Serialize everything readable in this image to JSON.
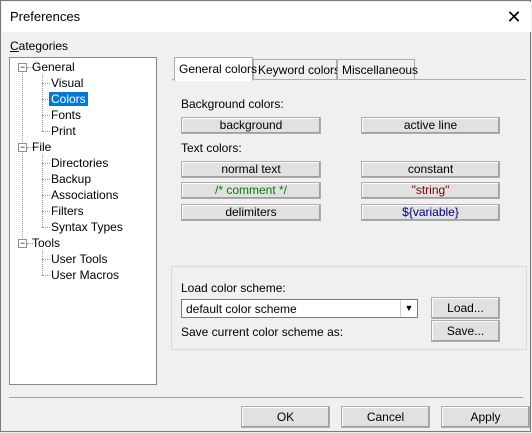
{
  "window": {
    "title": "Preferences",
    "close_label": "✕"
  },
  "categories_label_prefix": "C",
  "categories_label_rest": "ategories",
  "tree": {
    "general": "General",
    "visual": "Visual",
    "colors": "Colors",
    "fonts": "Fonts",
    "print": "Print",
    "file": "File",
    "directories": "Directories",
    "backup": "Backup",
    "associations": "Associations",
    "filters": "Filters",
    "syntax_types": "Syntax Types",
    "tools": "Tools",
    "user_tools": "User Tools",
    "user_macros": "User Macros",
    "expander_symbol": "−"
  },
  "tabs": {
    "general_colors": "General colors",
    "keyword_colors": "Keyword colors",
    "miscellaneous": "Miscellaneous"
  },
  "general_colors": {
    "background_colors_label": "Background colors:",
    "text_colors_label": "Text colors:",
    "background": "background",
    "active_line": "active line",
    "normal_text": "normal text",
    "constant": "constant",
    "comment": "/* comment */",
    "string": "\"string\"",
    "delimiters": "delimiters",
    "variable": "${variable}"
  },
  "scheme": {
    "load_label": "Load color scheme:",
    "selected": "default color scheme",
    "load_button": "Load...",
    "save_label": "Save current color scheme as:",
    "save_button": "Save..."
  },
  "footer": {
    "ok": "OK",
    "cancel": "Cancel",
    "apply": "Apply"
  },
  "colors": {
    "selection": "#0078d7",
    "comment_text": "#008000",
    "string_text": "#800000",
    "variable_text": "#000080"
  }
}
